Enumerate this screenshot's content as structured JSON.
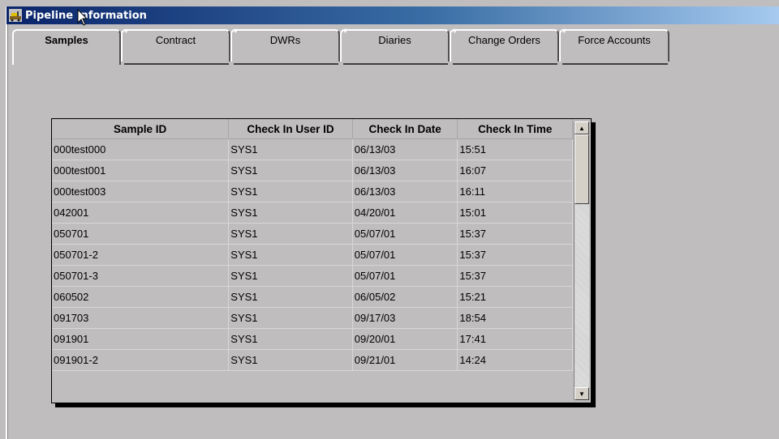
{
  "window": {
    "title": "Pipeline Information",
    "icon": "pipeline-app-icon"
  },
  "tabs": [
    {
      "label": "Samples",
      "active": true
    },
    {
      "label": "Contract",
      "active": false
    },
    {
      "label": "DWRs",
      "active": false
    },
    {
      "label": "Diaries",
      "active": false
    },
    {
      "label": "Change Orders",
      "active": false
    },
    {
      "label": "Force Accounts",
      "active": false
    }
  ],
  "table": {
    "headers": [
      "Sample ID",
      "Check In User ID",
      "Check In Date",
      "Check In Time"
    ],
    "rows": [
      [
        "000test000",
        "SYS1",
        "06/13/03",
        "15:51"
      ],
      [
        "000test001",
        "SYS1",
        "06/13/03",
        "16:07"
      ],
      [
        "000test003",
        "SYS1",
        "06/13/03",
        "16:11"
      ],
      [
        "042001",
        "SYS1",
        "04/20/01",
        "15:01"
      ],
      [
        "050701",
        "SYS1",
        "05/07/01",
        "15:37"
      ],
      [
        "050701-2",
        "SYS1",
        "05/07/01",
        "15:37"
      ],
      [
        "050701-3",
        "SYS1",
        "05/07/01",
        "15:37"
      ],
      [
        "060502",
        "SYS1",
        "06/05/02",
        "15:21"
      ],
      [
        "091703",
        "SYS1",
        "09/17/03",
        "18:54"
      ],
      [
        "091901",
        "SYS1",
        "09/20/01",
        "17:41"
      ],
      [
        "091901-2",
        "SYS1",
        "09/21/01",
        "14:24"
      ]
    ]
  },
  "scrollbar": {
    "up_icon": "scroll-up-arrow-icon",
    "down_icon": "scroll-down-arrow-icon",
    "position": 0
  },
  "colors": {
    "background": "#c0bdbf",
    "title_start": "#0a246a",
    "title_end": "#a6caf0"
  }
}
